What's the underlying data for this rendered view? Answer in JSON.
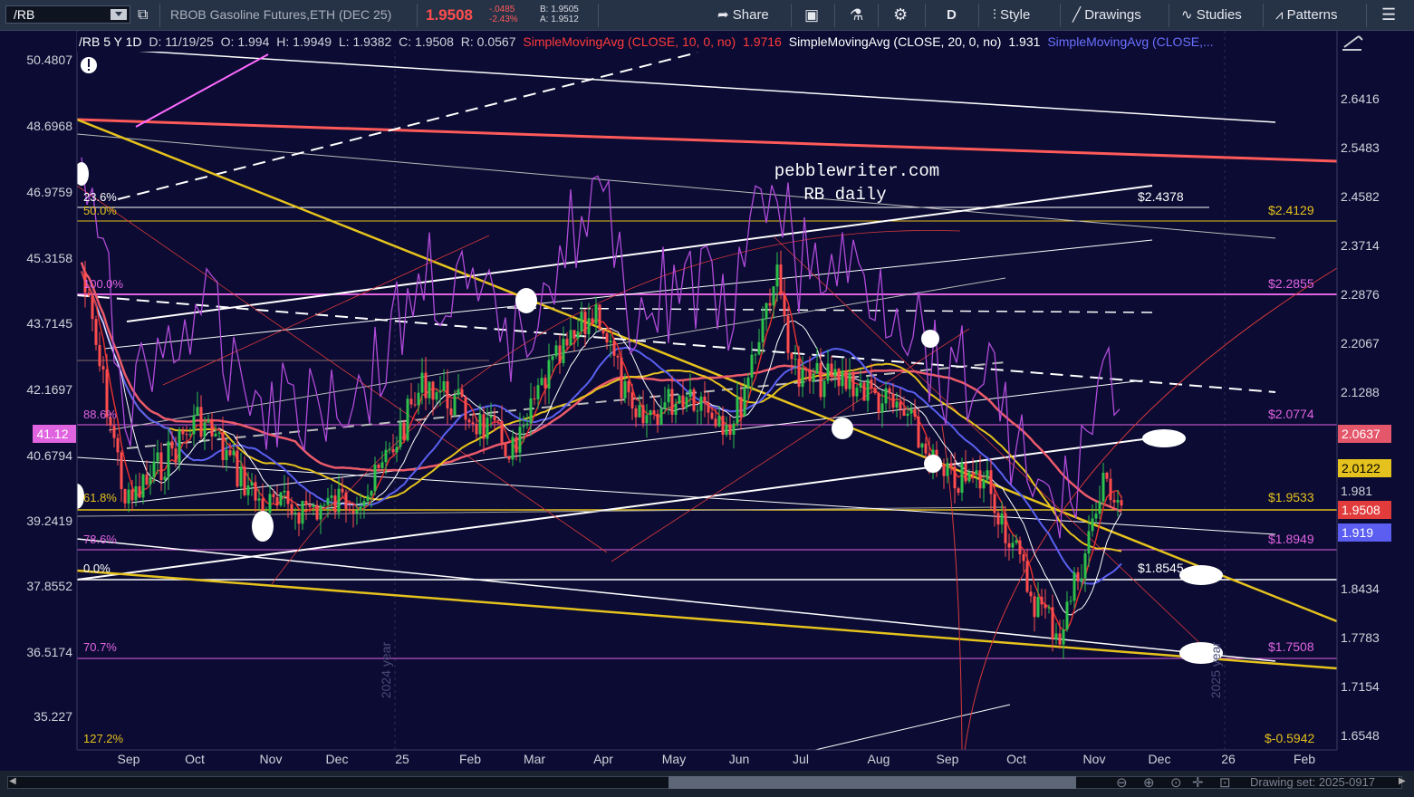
{
  "toolbar": {
    "symbol": "/RB",
    "description": "RBOB Gasoline Futures,ETH (DEC 25)",
    "last_price": "1.9508",
    "change": "-.0485",
    "change_pct": "-2.43%",
    "bid": "B: 1.9505",
    "ask": "A: 1.9512",
    "share_label": "Share",
    "timeframe_label": "D",
    "style_label": "Style",
    "drawings_label": "Drawings",
    "studies_label": "Studies",
    "patterns_label": "Patterns"
  },
  "info": {
    "period": "/RB 5 Y 1D",
    "date": "D: 11/19/25",
    "open": "O: 1.994",
    "high": "H: 1.9949",
    "low": "L: 1.9382",
    "close": "C: 1.9508",
    "range": "R: 0.0567",
    "sma10": "SimpleMovingAvg (CLOSE, 10, 0, no)",
    "sma10_val": "1.9716",
    "sma20": "SimpleMovingAvg (CLOSE, 20, 0, no)",
    "sma20_val": "1.931",
    "sma3": "SimpleMovingAvg (CLOSE,..."
  },
  "watermark": {
    "line1": "pebblewriter.com",
    "line2": "RB daily"
  },
  "left_axis": [
    "50.4807",
    "48.6968",
    "46.9759",
    "45.3158",
    "43.7145",
    "42.1697",
    "40.6794",
    "39.2419",
    "37.8552",
    "36.5174",
    "35.227"
  ],
  "left_price_tag": "41.12",
  "right_axis": [
    "2.6416",
    "2.5483",
    "2.4582",
    "2.3714",
    "2.2876",
    "2.2067",
    "2.1288",
    "1.981",
    "1.8434",
    "1.7783",
    "1.7154",
    "1.6548"
  ],
  "right_tags": [
    {
      "label": "2.0637",
      "color": "#e4566a",
      "text": "#ffffff"
    },
    {
      "label": "2.0122",
      "color": "#e5c21d",
      "text": "#000000"
    },
    {
      "label": "1.9508",
      "color": "#e23b3b",
      "text": "#ffffff"
    },
    {
      "label": "1.919",
      "color": "#5b5ef0",
      "text": "#ffffff"
    }
  ],
  "x_axis": [
    "Sep",
    "Oct",
    "Nov",
    "Dec",
    "25",
    "Feb",
    "Mar",
    "Apr",
    "May",
    "Jun",
    "Jul",
    "Aug",
    "Sep",
    "Oct",
    "Nov",
    "Dec",
    "26",
    "Feb"
  ],
  "year_labels": [
    "2024 year",
    "2025 year"
  ],
  "fib_left": [
    "23.6%",
    "50.0%",
    "100.0%",
    "88.6%",
    "61.8%",
    "78.6%",
    "0.0%",
    "70.7%",
    "127.2%"
  ],
  "price_levels": [
    "$2.4378",
    "$2.4129",
    "$2.2855",
    "$2.0774",
    "$1.9533",
    "$1.8949",
    "$1.8545",
    "$1.7508",
    "$-0.5942"
  ],
  "bottom": {
    "drawing_set": "Drawing set: 2025-0917"
  },
  "colors": {
    "background": "#0b0b33",
    "sma10": "#e0302f",
    "sma20": "#ffffff",
    "sma_blue": "#5a60f0",
    "sma_yellow": "#e5c21d",
    "sma_pink": "#ec5b6a",
    "fib_magenta": "#e063e0"
  }
}
